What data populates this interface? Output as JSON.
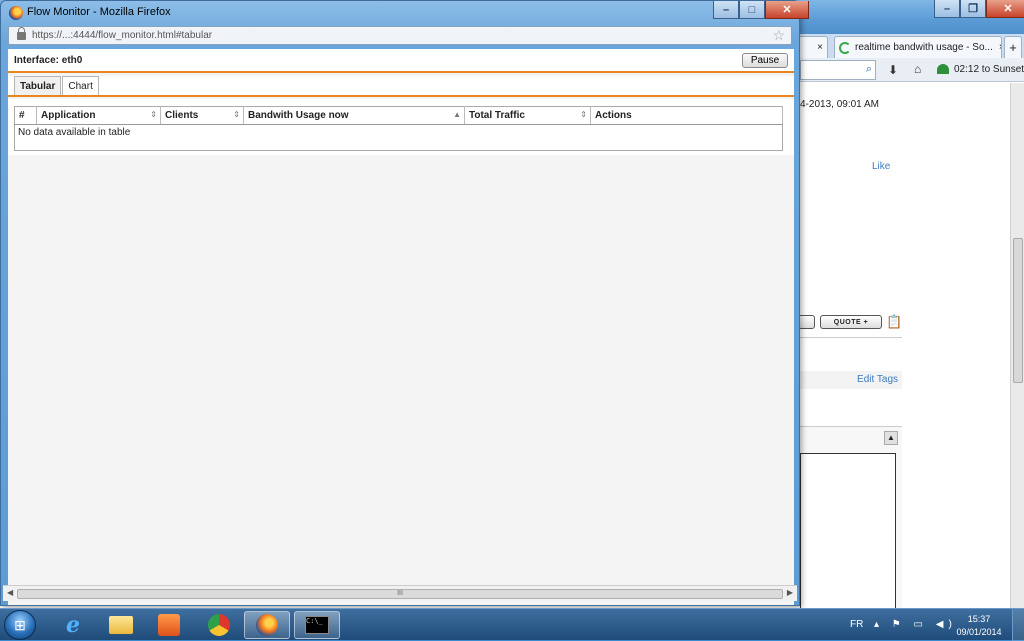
{
  "popup": {
    "title": "Flow Monitor - Mozilla Firefox",
    "url": "https://...:4444/flow_monitor.html#tabular",
    "interface_label": "Interface: eth0",
    "pause_label": "Pause",
    "tabs": [
      {
        "label": "Tabular",
        "active": true
      },
      {
        "label": "Chart",
        "active": false
      }
    ],
    "table": {
      "columns": [
        "#",
        "Application",
        "Clients",
        "Bandwith Usage now",
        "Total Traffic",
        "Actions"
      ],
      "empty_message": "No data available in table"
    },
    "scrollbar_grip": "III"
  },
  "background_browser": {
    "tab_title": "realtime bandwith usage - So...",
    "new_tab": "+",
    "tab_close": "×",
    "sunset_text": "02:12 to Sunset",
    "post_date": "4-2013, 09:01 AM",
    "like_text": "Like",
    "quote_label": "QUOTE +",
    "edit_tags": "Edit Tags"
  },
  "taskbar": {
    "language": "FR",
    "time": "15:37",
    "date": "09/01/2014",
    "apps": [
      "internet-explorer",
      "file-explorer",
      "media-player",
      "chrome",
      "firefox",
      "command-prompt"
    ]
  },
  "colors": {
    "accent_orange": "#e8851e",
    "window_blue": "#5d9bd4",
    "link_blue": "#3b7dc0"
  }
}
